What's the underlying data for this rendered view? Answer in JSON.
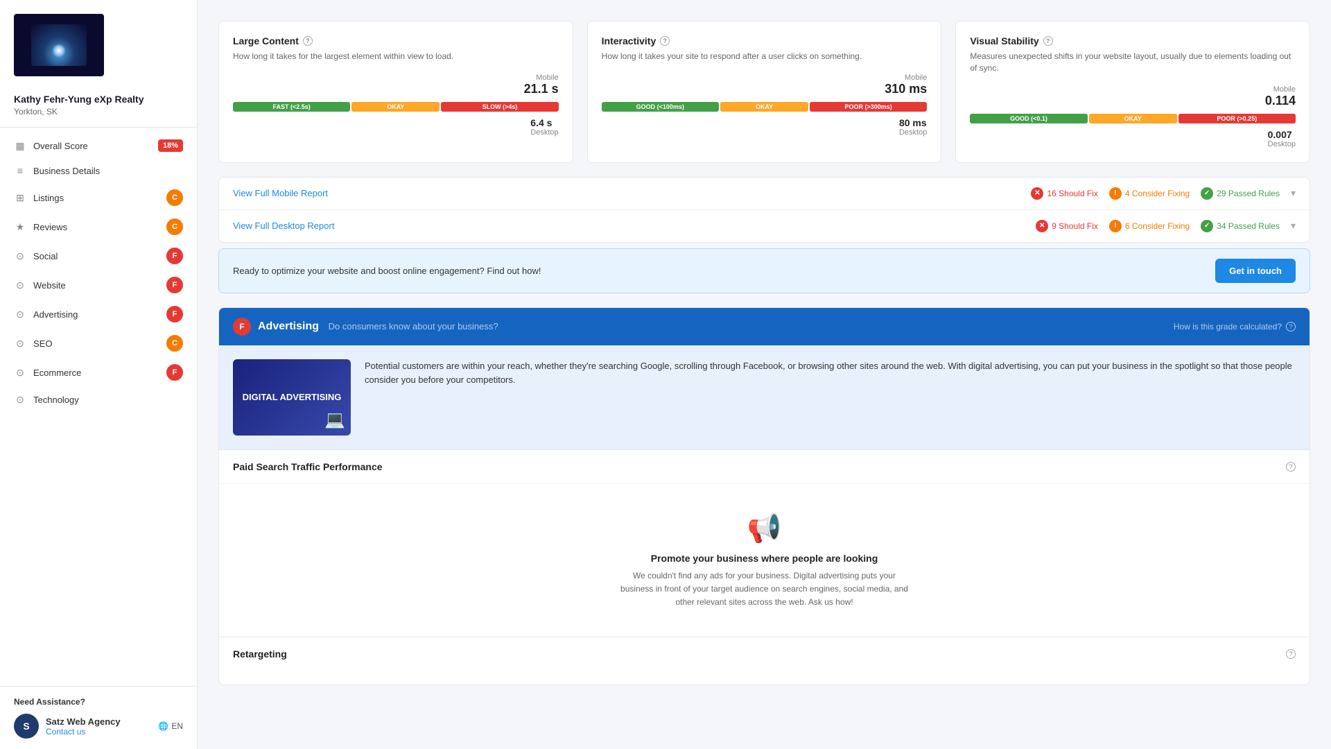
{
  "sidebar": {
    "business_name": "Kathy Fehr-Yung eXp Realty",
    "business_location": "Yorkton, SK",
    "nav_items": [
      {
        "id": "overall-score",
        "label": "Overall Score",
        "badge": "18%",
        "badge_color": "red"
      },
      {
        "id": "business-details",
        "label": "Business Details",
        "badge": null
      },
      {
        "id": "listings",
        "label": "Listings",
        "badge": "C",
        "badge_color": "orange"
      },
      {
        "id": "reviews",
        "label": "Reviews",
        "badge": "C",
        "badge_color": "orange"
      },
      {
        "id": "social",
        "label": "Social",
        "badge": "F",
        "badge_color": "red"
      },
      {
        "id": "website",
        "label": "Website",
        "badge": "F",
        "badge_color": "red"
      },
      {
        "id": "advertising",
        "label": "Advertising",
        "badge": "F",
        "badge_color": "red"
      },
      {
        "id": "seo",
        "label": "SEO",
        "badge": "C",
        "badge_color": "orange"
      },
      {
        "id": "ecommerce",
        "label": "Ecommerce",
        "badge": "F",
        "badge_color": "red"
      },
      {
        "id": "technology",
        "label": "Technology",
        "badge": null
      }
    ],
    "footer": {
      "need_assistance": "Need Assistance?",
      "agency_name": "Satz Web Agency",
      "contact_label": "Contact us",
      "language": "EN"
    }
  },
  "metrics": {
    "large_content": {
      "title": "Large Content",
      "subtitle": "How long it takes for the largest element within view to load.",
      "mobile_label": "Mobile",
      "mobile_value": "21.1 s",
      "desktop_value": "6.4 s",
      "desktop_label": "Desktop",
      "segments": [
        {
          "label": "FAST (<2.5s)",
          "class": "seg-fast"
        },
        {
          "label": "OKAY",
          "class": "seg-okay"
        },
        {
          "label": "SLOW (>4s)",
          "class": "seg-slow"
        }
      ],
      "pointer_position": "85%"
    },
    "interactivity": {
      "title": "Interactivity",
      "subtitle": "How long it takes your site to respond after a user clicks on something.",
      "mobile_label": "Mobile",
      "mobile_value": "310 ms",
      "desktop_value": "80 ms",
      "desktop_label": "Desktop",
      "segments": [
        {
          "label": "GOOD (<100ms)",
          "class": "seg-good"
        },
        {
          "label": "OKAY",
          "class": "seg-okay"
        },
        {
          "label": "POOR (>300ms)",
          "class": "seg-poor"
        }
      ],
      "pointer_position": "90%"
    },
    "visual_stability": {
      "title": "Visual Stability",
      "subtitle": "Measures unexpected shifts in your website layout, usually due to elements loading out of sync.",
      "mobile_label": "Mobile",
      "mobile_value": "0.114",
      "desktop_value": "0.007",
      "desktop_label": "Desktop",
      "segments": [
        {
          "label": "GOOD (<0.1)",
          "class": "seg-good"
        },
        {
          "label": "OKAY",
          "class": "seg-okay"
        },
        {
          "label": "POOR (>0.25)",
          "class": "seg-poor"
        }
      ],
      "pointer_position": "38%"
    }
  },
  "reports": {
    "mobile": {
      "label": "View Full Mobile Report",
      "should_fix": "16 Should Fix",
      "consider_fixing": "4 Consider Fixing",
      "passed_rules": "29 Passed Rules"
    },
    "desktop": {
      "label": "View Full Desktop Report",
      "should_fix": "9 Should Fix",
      "consider_fixing": "6 Consider Fixing",
      "passed_rules": "34 Passed Rules"
    }
  },
  "cta": {
    "text": "Ready to optimize your website and boost online engagement? Find out how!",
    "button_label": "Get in touch"
  },
  "advertising": {
    "grade": "F",
    "title": "Advertising",
    "subtitle": "Do consumers know about your business?",
    "how_calculated": "How is this grade calculated?",
    "description": "Potential customers are within your reach, whether they're searching Google, scrolling through Facebook, or browsing other sites around the web. With digital advertising, you can put your business in the spotlight so that those people consider you before your competitors.",
    "image_title": "DIGITAL ADVERTISING",
    "paid_search": {
      "title": "Paid Search Traffic Performance",
      "empty_icon": "📢",
      "empty_title": "Promote your business where people are looking",
      "empty_desc": "We couldn't find any ads for your business. Digital advertising puts your business in front of your target audience on search engines, social media, and other relevant sites across the web. Ask us how!"
    },
    "retargeting": {
      "title": "Retargeting"
    }
  }
}
